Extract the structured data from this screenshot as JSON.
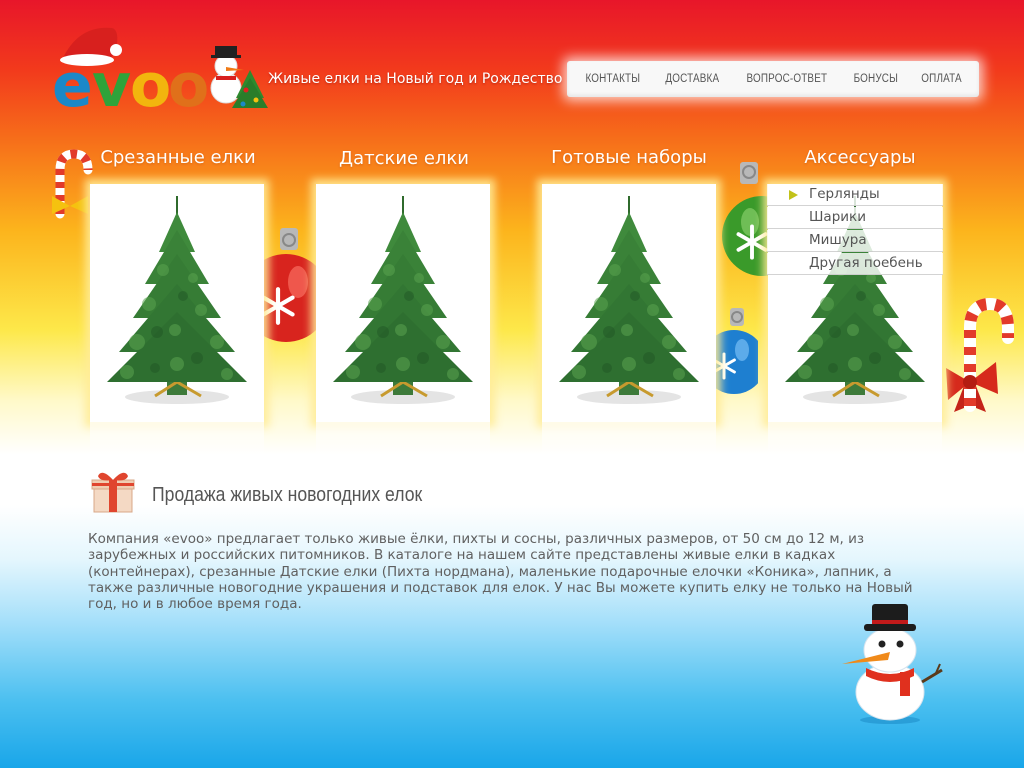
{
  "header": {
    "logo_text": "evoo",
    "tagline": "Живые елки на Новый год и Рождество"
  },
  "nav": {
    "items": [
      "КОНТАКТЫ",
      "ДОСТАВКА",
      "ВОПРОС-ОТВЕТ",
      "БОНУСЫ",
      "ОПЛАТА"
    ]
  },
  "categories": [
    {
      "title": "Срезанные елки"
    },
    {
      "title": "Датские елки"
    },
    {
      "title": "Готовые наборы"
    },
    {
      "title": "Аксессуары"
    }
  ],
  "accessories_menu": {
    "items": [
      "Герлянды",
      "Шарики",
      "Мишура",
      "Другая поебень"
    ],
    "active_index": 0
  },
  "content": {
    "heading": "Продажа живых новогодних елок",
    "description": "Компания «evoo» предлагает только живые ёлки, пихты и сосны, различных размеров, от 50 см до 12 м, из зарубежных и российских питомников. В каталоге на нашем сайте представлены живые елки в кадках (контейнерах), срезанные Датские елки (Пихта нордмана), маленькие подарочные елочки «Коника», лапник, а также различные новогодние украшения и подставок для елок. У нас Вы можете купить елку не только на Новый год, но и в любое время года."
  },
  "icons": {
    "logo": "evoo-logo-with-santa-hat",
    "gift": "gift-box-icon",
    "snowman": "snowman-icon",
    "ornament_red": "red-ornament-icon",
    "ornament_green": "green-ornament-icon",
    "ornament_blue": "blue-ornament-icon",
    "candy_cane": "candy-cane-icon",
    "tree": "christmas-tree-image"
  },
  "colors": {
    "background_top": "#e8162a",
    "background_middle": "#fde84a",
    "background_bottom": "#19a6e9",
    "text": "#606060",
    "menu_arrow": "#c2c21a"
  }
}
